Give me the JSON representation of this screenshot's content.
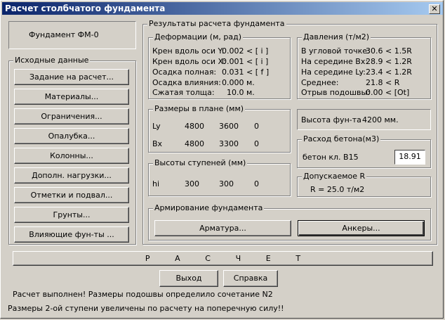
{
  "window": {
    "title": "Расчет столбчатого фундамента",
    "close_label": "✕"
  },
  "foundation_name": "Фундамент ФМ-0",
  "input_data": {
    "legend": "Исходные данные",
    "buttons": [
      "Задание на расчет...",
      "Материалы...",
      "Ограничения...",
      "Опалубка...",
      "Колонны...",
      "Дополн. нагрузки...",
      "Отметки и подвал...",
      "Грунты...",
      "Влияющие фун-ты ..."
    ]
  },
  "results": {
    "legend": "Результаты расчета фундамента",
    "deformations": {
      "legend": "Деформации  (м, рад)",
      "rows": [
        {
          "label": "Крен вдоль оси Y:",
          "value": "0.002 < [ i ]"
        },
        {
          "label": "Крен вдоль оси X:",
          "value": "0.001 < [ i ]"
        },
        {
          "label": "Осадка полная:",
          "value": "0.031 < [ f ]"
        },
        {
          "label": "Осадка влияния:",
          "value": "0.000 м."
        },
        {
          "label": "Сжатая толща:",
          "value": "10.0 м."
        }
      ]
    },
    "pressures": {
      "legend": "Давления (т/м2)",
      "rows": [
        {
          "label": "В угловой точке:",
          "value": "30.6 < 1.5R"
        },
        {
          "label": "На середине Bx:",
          "value": "28.9 < 1.2R"
        },
        {
          "label": "На середине Ly:",
          "value": "23.4 < 1.2R"
        },
        {
          "label": "Среднее:",
          "value": "21.8 <  R"
        },
        {
          "label": "Отрыв подошвы:",
          "value": "0.00 < [Ot]"
        }
      ]
    },
    "plan_sizes": {
      "legend": "Размеры в плане (мм)",
      "rows": [
        {
          "label": "Ly",
          "v1": "4800",
          "v2": "3600",
          "v3": "0"
        },
        {
          "label": "Bx",
          "v1": "4800",
          "v2": "3300",
          "v3": "0"
        }
      ]
    },
    "step_heights": {
      "legend": "Высоты ступеней (мм)",
      "label": "hi",
      "v1": "300",
      "v2": "300",
      "v3": "0"
    },
    "height": {
      "label": "Высота фун-та",
      "value": "4200 мм."
    },
    "concrete": {
      "legend": "Расход бетона(м3)",
      "label": "бетон кл. B15",
      "value": "18.91"
    },
    "allowable": {
      "legend": "Допускаемое  R",
      "value": "R  =  25.0 т/м2"
    },
    "reinforcement": {
      "legend": "Армирование фундамента",
      "armature_button": "Арматура...",
      "anchors_button": "Анкеры..."
    }
  },
  "calc_button_letters": [
    "Р",
    "А",
    "С",
    "Ч",
    "Е",
    "Т"
  ],
  "exit_button": "Выход",
  "help_button": "Справка",
  "status": {
    "line1": "Расчет выполнен! Размеры подошвы определило сочетание  N2",
    "line2": "Размеры 2-ой ступени увеличены по расчету на поперечную силу!!"
  }
}
